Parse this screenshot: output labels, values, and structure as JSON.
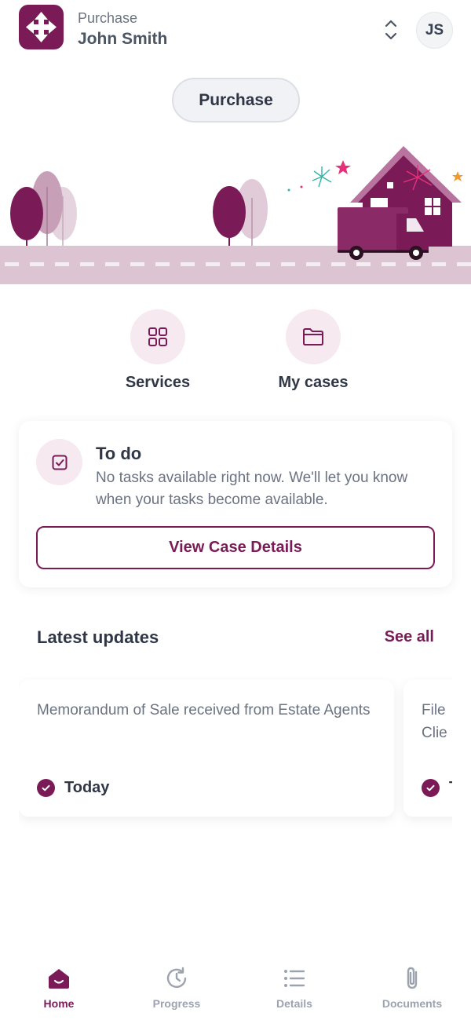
{
  "header": {
    "case_type": "Purchase",
    "client_name": "John Smith",
    "avatar_initials": "JS"
  },
  "case_pill": "Purchase",
  "quick_actions": [
    {
      "label": "Services",
      "icon": "grid-icon"
    },
    {
      "label": "My cases",
      "icon": "folder-icon"
    }
  ],
  "todo": {
    "title": "To do",
    "text": "No tasks available right now. We'll let you know when your tasks become available.",
    "button": "View Case Details"
  },
  "updates": {
    "title": "Latest updates",
    "see_all": "See all",
    "items": [
      {
        "text": "Memorandum of Sale received from Estate Agents",
        "date": "Today"
      },
      {
        "text": "File Clie",
        "date": "T"
      }
    ]
  },
  "bottom_nav": [
    {
      "label": "Home",
      "icon": "home-icon",
      "active": true
    },
    {
      "label": "Progress",
      "icon": "clock-icon",
      "active": false
    },
    {
      "label": "Details",
      "icon": "list-icon",
      "active": false
    },
    {
      "label": "Documents",
      "icon": "paperclip-icon",
      "active": false
    }
  ],
  "colors": {
    "brand": "#7a1b57",
    "brand_light": "#f6e9f0",
    "text_dark": "#2f3646",
    "text_muted": "#6b7280",
    "nav_inactive": "#9ca3af"
  }
}
